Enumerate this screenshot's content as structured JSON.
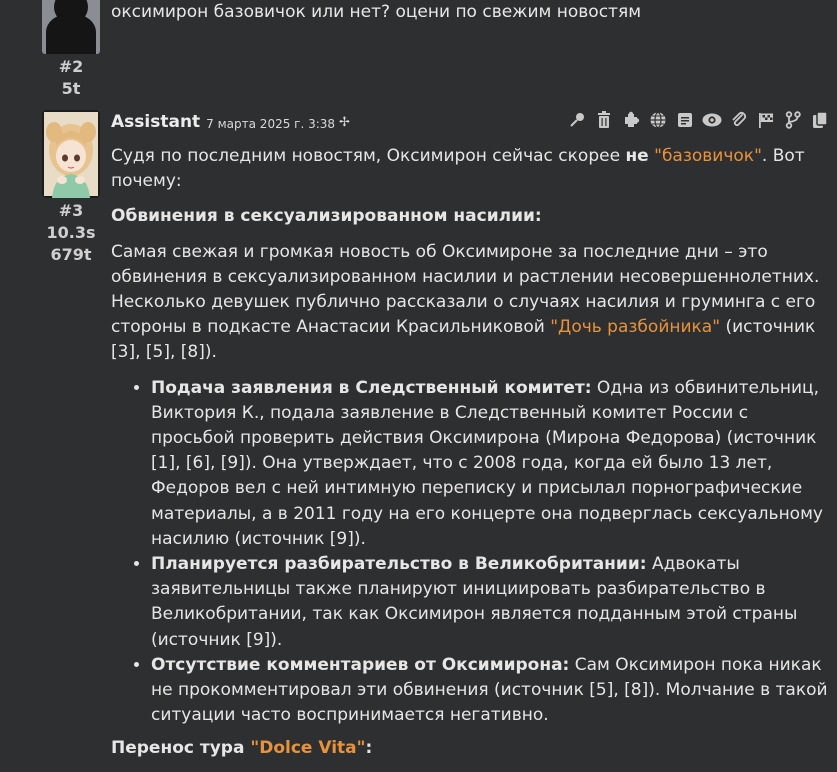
{
  "previous_message": {
    "text": "оксимирон базовичок или нет? оцени по свежим новостям",
    "index": "#2",
    "tokens": "5t"
  },
  "message": {
    "author": "Assistant",
    "date": "7 марта 2025 г. 3:38",
    "index": "#3",
    "time": "10.3s",
    "tokens": "679t",
    "toolbar": [
      "pin-icon",
      "trash-icon",
      "puzzle-icon",
      "globe-icon",
      "note-icon",
      "eye-icon",
      "paperclip-icon",
      "flag-icon",
      "branch-icon",
      "copy-icon"
    ],
    "intro_a": "Судя по последним новостям, Оксимирон сейчас скорее ",
    "intro_bold": "не",
    "intro_space": " ",
    "intro_link": "\"базовичок\"",
    "intro_b": ". Вот почему:",
    "h1": "Обвинения в сексуализированном насилии:",
    "p1_a": "Самая свежая и громкая новость об Оксимироне за последние дни – это обвинения в сексуализированном насилии и растлении несовершеннолетних. Несколько девушек публично рассказали о случаях насилия и груминга с его стороны в подкасте Анастасии Красильниковой ",
    "p1_link": "\"Дочь разбойника\"",
    "p1_b": " (источник [3], [5], [8]).",
    "bullets": [
      {
        "title": "Подача заявления в Следственный комитет:",
        "text": " Одна из обвинительниц, Виктория К., подала заявление в Следственный комитет России с просьбой проверить действия Оксимирона (Мирона Федорова) (источник [1], [6], [9]). Она утверждает, что с 2008 года, когда ей было 13 лет, Федоров вел с ней интимную переписку и присылал порнографические материалы, а в 2011 году на его концерте она подверглась сексуальному насилию (источник [9])."
      },
      {
        "title": "Планируется разбирательство в Великобритании:",
        "text": " Адвокаты заявительницы также планируют инициировать разбирательство в Великобритании, так как Оксимирон является подданным этой страны (источник [9])."
      },
      {
        "title": "Отсутствие комментариев от Оксимирона:",
        "text": " Сам Оксимирон пока никак не прокомментировал эти обвинения (источник [5], [8]). Молчание в такой ситуации часто воспринимается негативно."
      }
    ],
    "h2_a": "Перенос тура ",
    "h2_link": "\"Dolce Vita\"",
    "h2_b": ":"
  }
}
